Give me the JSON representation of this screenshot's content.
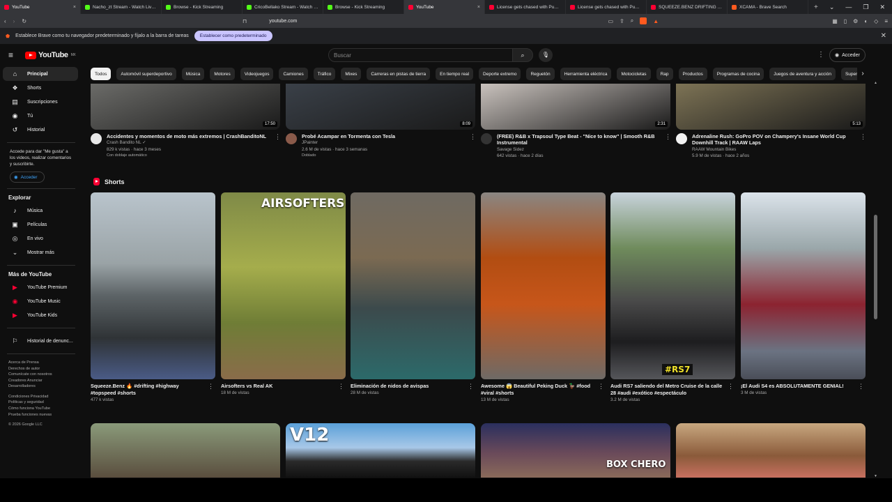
{
  "browser": {
    "tabs": [
      {
        "title": "YouTube",
        "color": "#ff0033"
      },
      {
        "title": "Nacho_zt Stream - Watch Live on K",
        "color": "#53fc18"
      },
      {
        "title": "Browse - Kick Streaming",
        "color": "#53fc18"
      },
      {
        "title": "CricoBellako Stream - Watch Live o",
        "color": "#53fc18"
      },
      {
        "title": "Browse - Kick Streaming",
        "color": "#53fc18"
      },
      {
        "title": "YouTube",
        "color": "#ff0033"
      },
      {
        "title": "License gets chased with Punchma",
        "color": "#ff0033"
      },
      {
        "title": "License gets chased with Punchma",
        "color": "#ff0033"
      },
      {
        "title": "SQUEEZE.BENZ DRIFTING ON TIME",
        "color": "#ff0033"
      },
      {
        "title": "XCAMA - Brave Search",
        "color": "#ff5a1f"
      }
    ],
    "close_glyph": "×",
    "new_tab_glyph": "+",
    "window_controls": [
      "⌄",
      "—",
      "❐",
      "✕"
    ],
    "url": "youtube.com",
    "infobar_text": "Establece Brave como tu navegador predeterminado y fíjalo a la barra de tareas",
    "infobar_button": "Establecer como predeterminado"
  },
  "header": {
    "logo_text": "YouTube",
    "logo_sup": "MX",
    "search_placeholder": "Buscar",
    "signin_label": "Acceder"
  },
  "sidebar": {
    "main": [
      {
        "label": "Principal",
        "icon": "home-icon",
        "glyph": "⌂"
      },
      {
        "label": "Shorts",
        "icon": "shorts-icon",
        "glyph": "❖"
      },
      {
        "label": "Suscripciones",
        "icon": "subscriptions-icon",
        "glyph": "▤"
      },
      {
        "label": "Tú",
        "icon": "you-icon",
        "glyph": "◉"
      },
      {
        "label": "Historial",
        "icon": "history-icon",
        "glyph": "↺"
      }
    ],
    "signin_prompt": "Accede para dar \"Me gusta\" a los videos, realizar comentarios y suscribirte.",
    "signin_button": "Acceder",
    "explore_heading": "Explorar",
    "explore": [
      {
        "label": "Música",
        "icon": "music-icon",
        "glyph": "♪"
      },
      {
        "label": "Películas",
        "icon": "movies-icon",
        "glyph": "▣"
      },
      {
        "label": "En vivo",
        "icon": "live-icon",
        "glyph": "◎"
      },
      {
        "label": "Mostrar más",
        "icon": "chevron-down-icon",
        "glyph": "⌄"
      }
    ],
    "more_heading": "Más de YouTube",
    "more": [
      {
        "label": "YouTube Premium",
        "icon": "youtube-premium-icon",
        "glyph": "▶"
      },
      {
        "label": "YouTube Music",
        "icon": "youtube-music-icon",
        "glyph": "◉"
      },
      {
        "label": "YouTube Kids",
        "icon": "youtube-kids-icon",
        "glyph": "▶"
      }
    ],
    "report_history": "Historial de denunc...",
    "footer_lines": [
      "Acerca de  Prensa",
      "Derechos de autor",
      "Comunícate con nosotros",
      "Creadores  Anunciar",
      "Desarrolladores",
      "",
      "Condiciones  Privacidad",
      "Políticas y seguridad",
      "Cómo funciona YouTube",
      "Prueba funciones nuevas",
      "",
      "© 2026 Google LLC"
    ]
  },
  "chips": [
    "Todos",
    "Automóvil superdeportivo",
    "Música",
    "Motores",
    "Videojuegos",
    "Camiones",
    "Tráfico",
    "Mixes",
    "Carreras en pistas de tierra",
    "En tiempo real",
    "Deporte extremo",
    "Reguetón",
    "Herramienta eléctrica",
    "Motocicletas",
    "Rap",
    "Productos",
    "Programas de cocina",
    "Juegos de aventura y acción",
    "Supercars"
  ],
  "videos": [
    {
      "title": "Accidentes y momentos de moto más extremos | CrashBanditoNL",
      "channel": "Crash Bandito NL ✓",
      "stats": "829 k vistas · hace 3 meses",
      "badge": "Con doblaje automático",
      "duration": "17:50",
      "thumb_color": "#6b6b68",
      "avatar_color": "#e8e8e8"
    },
    {
      "title": "Probé Acampar en Tormenta con Tesla",
      "channel": "JPainter",
      "stats": "2.6 M de vistas · hace 3 semanas",
      "badge": "Doblado",
      "duration": "8:09",
      "thumb_color": "#3a4048",
      "avatar_color": "#8a5a4a"
    },
    {
      "title": "(FREE) R&B x Trapsoul Type Beat - \"Nice to know\" | Smooth R&B Instrumental",
      "channel": "Savage Sidez",
      "stats": "642 vistas · hace 2 días",
      "badge": "",
      "duration": "2:31",
      "thumb_color": "#c9c2bd",
      "avatar_color": "#333"
    },
    {
      "title": "Adrenaline Rush: GoPro POV on Champery's Insane World Cup Downhill Track | RAAW Laps",
      "channel": "RAAW Mountain Bikes",
      "stats": "5.9 M de vistas · hace 2 años",
      "badge": "",
      "duration": "5:13",
      "thumb_color": "#7d7355",
      "avatar_color": "#f2f2f2"
    }
  ],
  "shorts_heading": "Shorts",
  "shorts": [
    {
      "title": "Squeeze.Benz 🔥 #drifting #highway #topspeed #shorts",
      "views": "477 k vistas",
      "overlay": ""
    },
    {
      "title": "Airsofters vs Real AK",
      "views": "18 M de vistas",
      "overlay": "AIRSOFTERS"
    },
    {
      "title": "Eliminación de nidos de avispas",
      "views": "28 M de vistas",
      "overlay": ""
    },
    {
      "title": "Awesome 😱 Beautiful Peking Duck 🦆 #food #viral #shorts",
      "views": "13 M de vistas",
      "overlay": ""
    },
    {
      "title": "Audi RS7 saliendo del Metro Cruise de la calle 28 #audi #exótico #espectáculo",
      "views": "3.2 M de vistas",
      "overlay": "#RS7"
    },
    {
      "title": "¡El Audi S4 es ABSOLUTAMENTE GENIAL!",
      "views": "3 M de vistas",
      "overlay": ""
    }
  ],
  "bottom_row_overlays": [
    "",
    "V12",
    "BOX CHERO",
    ""
  ]
}
